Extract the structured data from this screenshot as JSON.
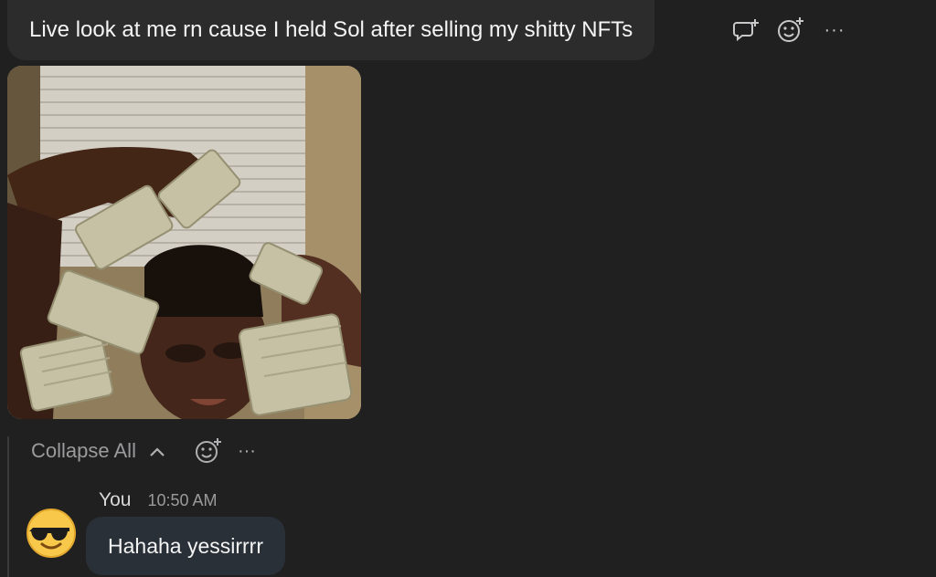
{
  "message": {
    "text": "Live look at me rn cause I held Sol after selling my shitty NFTs"
  },
  "actions": {
    "reply_icon": "reply-in-thread-icon",
    "react_icon": "add-reaction-icon",
    "more_label": "···"
  },
  "attachment": {
    "type": "gif",
    "subject": "person holding stacks of cash"
  },
  "thread": {
    "collapse_label": "Collapse All",
    "collapse_icon": "chevron-up-icon",
    "react_icon": "add-reaction-icon",
    "more_label": "···"
  },
  "reply": {
    "author": "You",
    "time": "10:50 AM",
    "text": "Hahaha yessirrrr",
    "avatar_icon": "sunglasses-emoji-icon"
  },
  "colors": {
    "background": "#202020",
    "bubble": "#2c2c2d",
    "reply_bubble": "#2a3038",
    "muted_text": "#9b9b9d"
  }
}
